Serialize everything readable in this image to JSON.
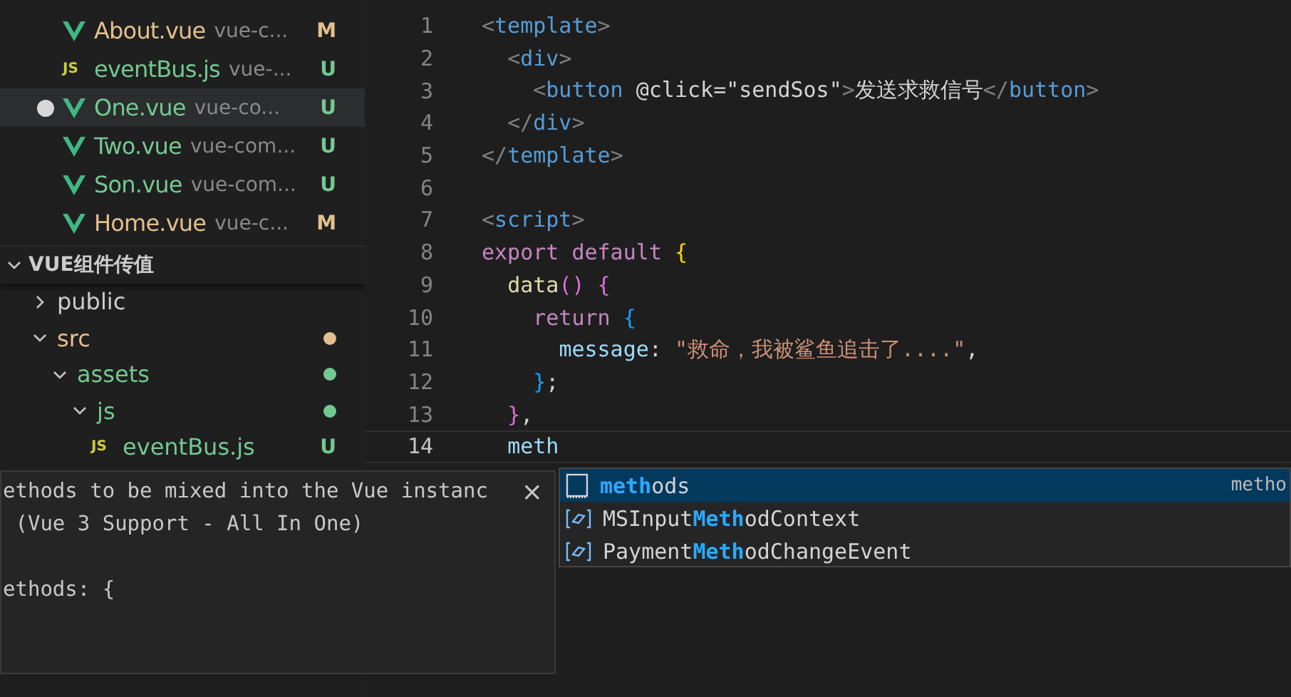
{
  "open_editors": [
    {
      "kind": "vue",
      "name": "About.vue",
      "hint": "vue-c...",
      "status": "M",
      "color": "#e2c08d",
      "selected": false,
      "unsaved": false
    },
    {
      "kind": "js",
      "badge": "JS",
      "name": "eventBus.js",
      "hint": "vue-...",
      "status": "U",
      "color": "#73c991",
      "selected": false,
      "unsaved": false
    },
    {
      "kind": "vue",
      "name": "One.vue",
      "hint": "vue-co...",
      "status": "U",
      "color": "#73c991",
      "selected": true,
      "unsaved": true
    },
    {
      "kind": "vue",
      "name": "Two.vue",
      "hint": "vue-com...",
      "status": "U",
      "color": "#73c991",
      "selected": false,
      "unsaved": false
    },
    {
      "kind": "vue",
      "name": "Son.vue",
      "hint": "vue-com...",
      "status": "U",
      "color": "#73c991",
      "selected": false,
      "unsaved": false
    },
    {
      "kind": "vue",
      "name": "Home.vue",
      "hint": "vue-c...",
      "status": "M",
      "color": "#e2c08d",
      "selected": false,
      "unsaved": false
    }
  ],
  "explorer": {
    "title": "VUE组件传值",
    "expanded": true,
    "items": [
      {
        "kind": "folder",
        "name": "public",
        "expanded": false
      },
      {
        "kind": "folder",
        "name": "src",
        "expanded": true,
        "color": "#e2c08d",
        "children": [
          {
            "kind": "folder",
            "name": "assets",
            "expanded": true,
            "color": "#73c991",
            "children": [
              {
                "kind": "folder",
                "name": "js",
                "expanded": true,
                "color": "#73c991",
                "children": [
                  {
                    "kind": "js",
                    "badge": "JS",
                    "name": "eventBus.js",
                    "status": "U",
                    "color": "#73c991"
                  }
                ]
              }
            ]
          }
        ]
      }
    ]
  },
  "editor": {
    "lines": [
      {
        "number": "1",
        "current": false,
        "text": "<template>"
      },
      {
        "number": "2",
        "current": false,
        "text": "  <div>"
      },
      {
        "number": "3",
        "current": false,
        "text": "    <button @click=\"sendSos\">发送求救信号</button>"
      },
      {
        "number": "4",
        "current": false,
        "text": "  </div>"
      },
      {
        "number": "5",
        "current": false,
        "text": "</template>"
      },
      {
        "number": "6",
        "current": false
      },
      {
        "number": "7",
        "current": false,
        "text": "<script>"
      },
      {
        "number": "8",
        "current": false,
        "text": "export default {"
      },
      {
        "number": "9",
        "current": false,
        "text": "  data() {"
      },
      {
        "number": "10",
        "current": false,
        "text": "    return {"
      },
      {
        "number": "11",
        "current": false,
        "text": "      message: \"救命，我被鲨鱼追击了....\","
      },
      {
        "number": "12",
        "current": false,
        "text": "    };"
      },
      {
        "number": "13",
        "current": false,
        "text": "  },"
      },
      {
        "number": "14",
        "current": true,
        "text": "  meth"
      }
    ]
  },
  "hover": {
    "lines": [
      "ethods to be mixed into the Vue instanc",
      " (Vue 3 Support - All In One)"
    ],
    "signature": "ethods: {",
    "close": "×"
  },
  "suggestions": [
    {
      "kind": "property",
      "selected": true,
      "label": "**meth**ods",
      "detail": "metho"
    },
    {
      "kind": "interface",
      "selected": false,
      "label": "MSInput**Meth**odContext"
    },
    {
      "kind": "interface",
      "selected": false,
      "label": "Payment**Meth**odChangeEvent"
    }
  ]
}
